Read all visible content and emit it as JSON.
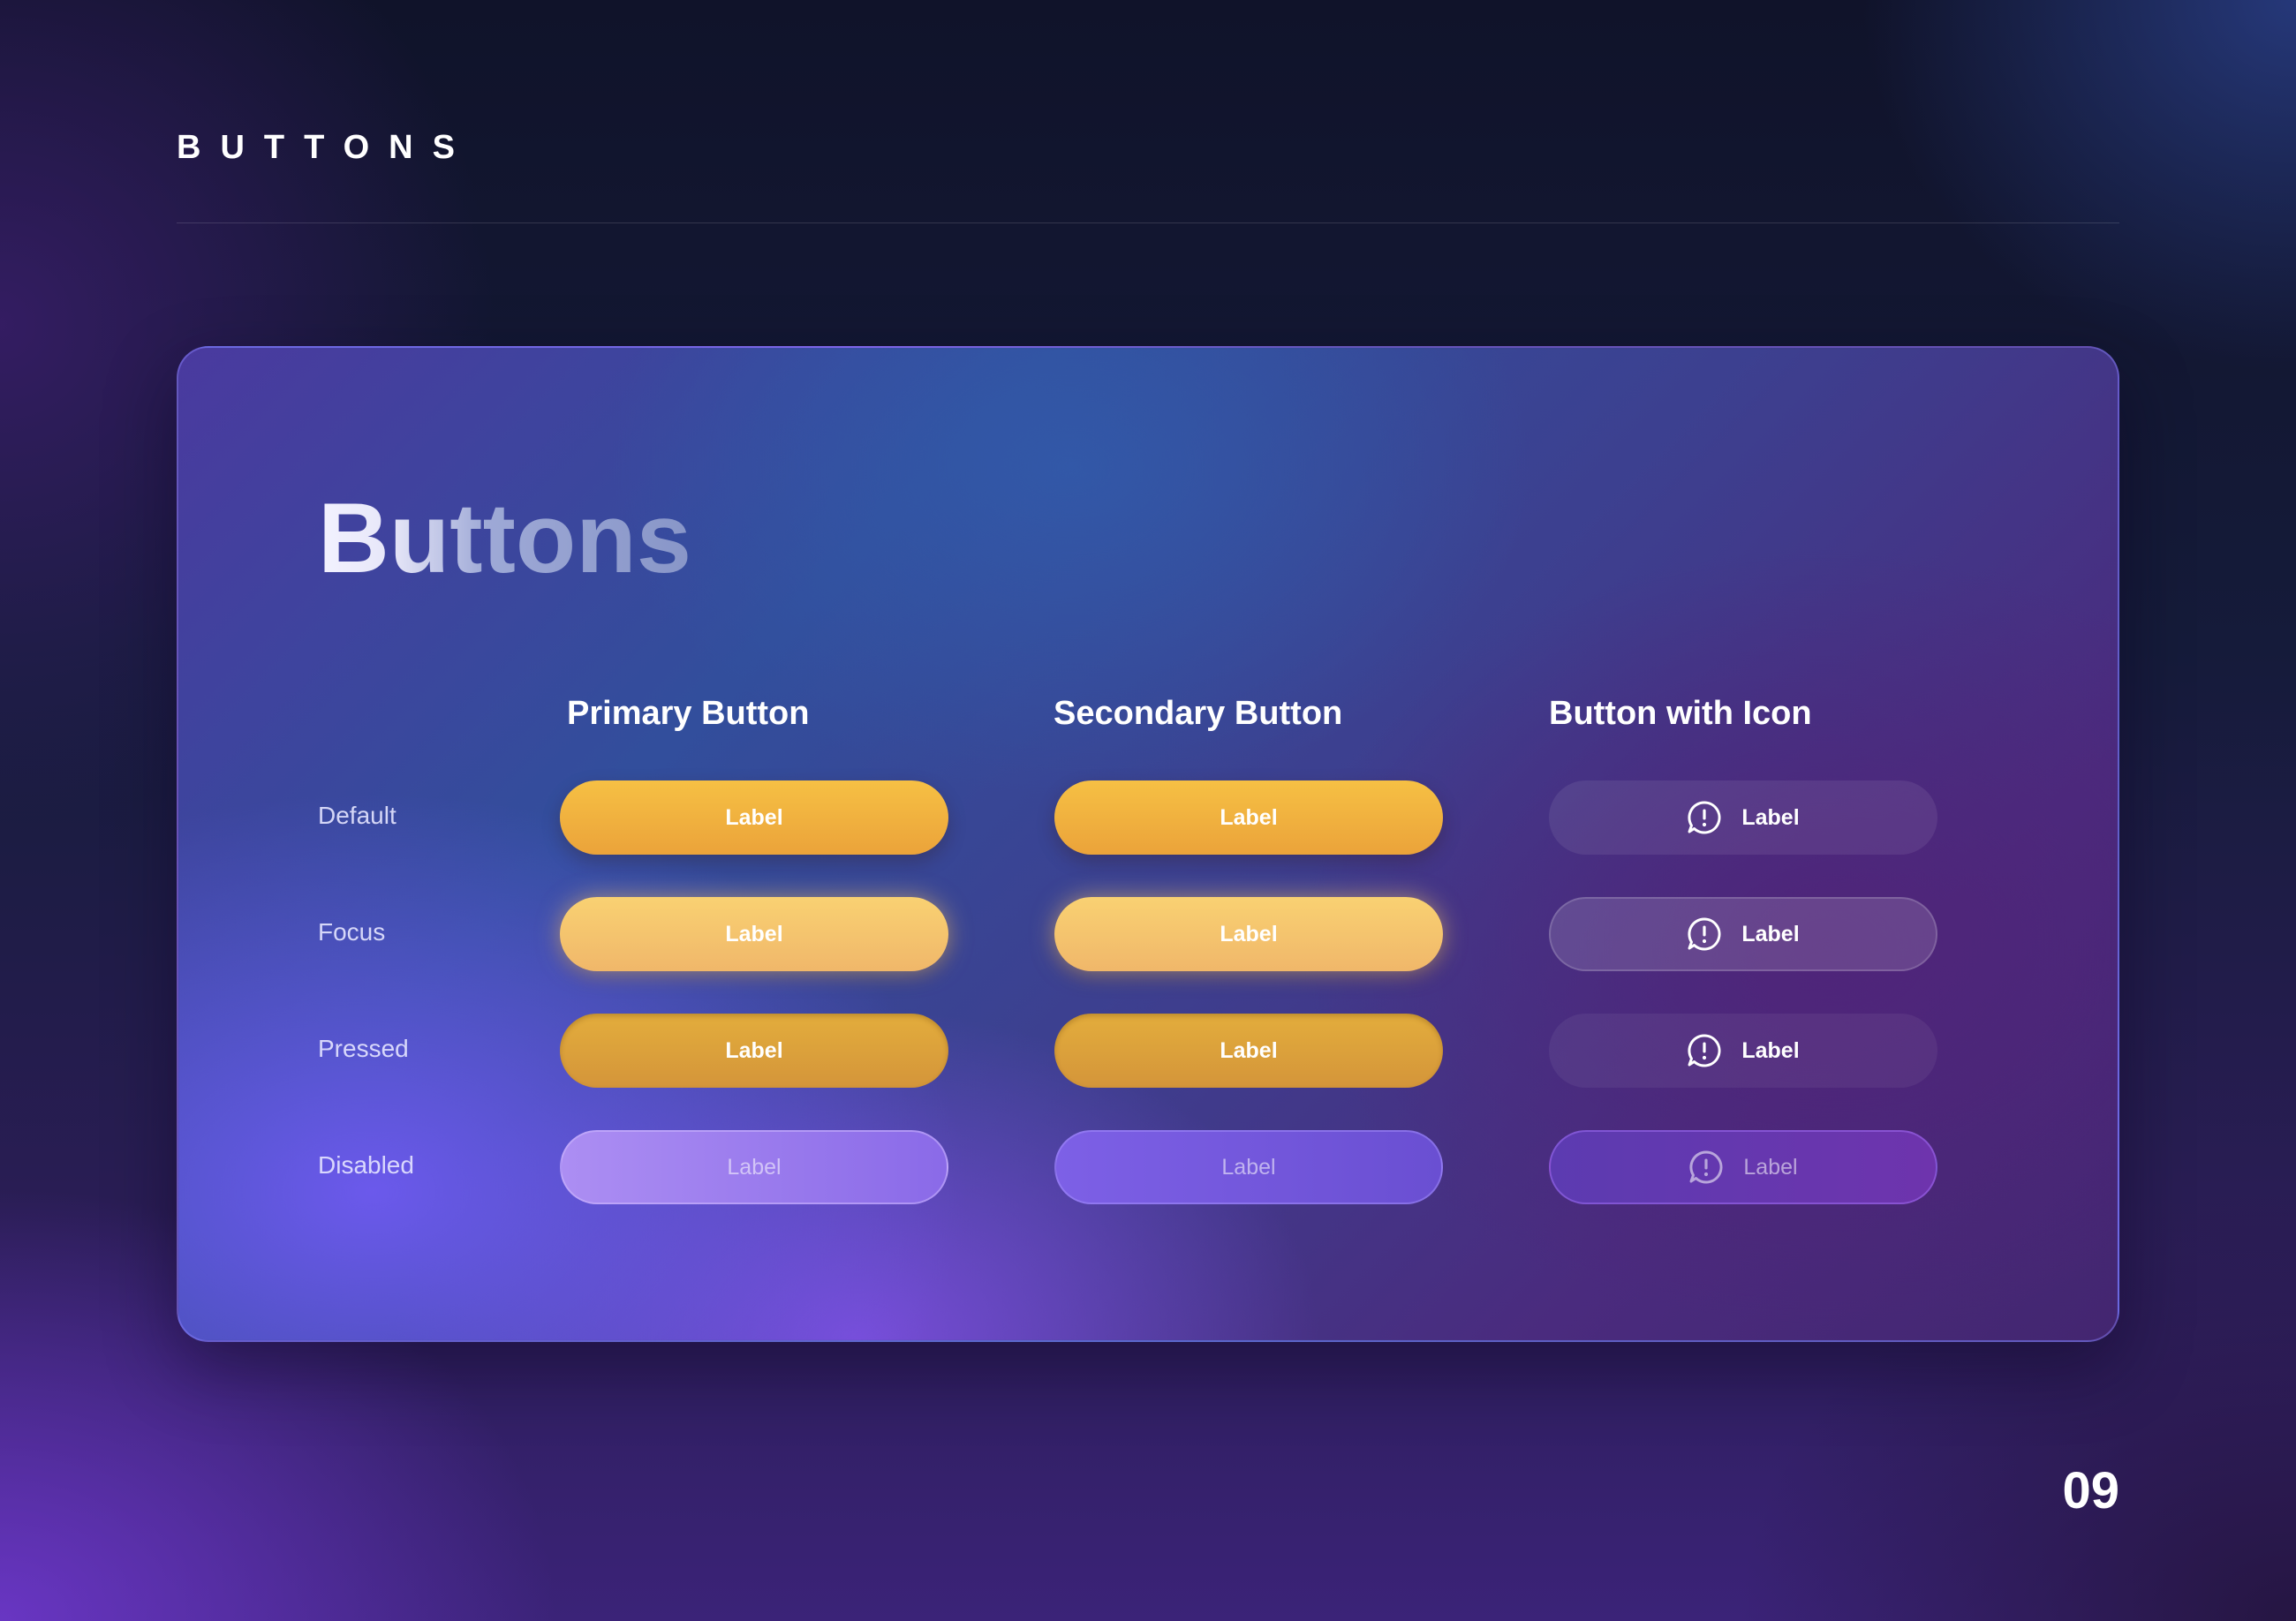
{
  "header": {
    "title": "BUTTONS"
  },
  "card": {
    "title": "Buttons",
    "columns": [
      "Primary Button",
      "Secondary Button",
      "Button with Icon"
    ],
    "rows": [
      "Default",
      "Focus",
      "Pressed",
      "Disabled"
    ],
    "button_label": "Label",
    "icon": "alert-message-icon"
  },
  "page_number": "09",
  "colors": {
    "primary_default": "#F2B13F",
    "primary_focus": "#F5C46F",
    "primary_pressed": "#DBA13B",
    "disabled_primary": "#9B7CEE",
    "disabled_secondary": "#7358DC",
    "disabled_icon": "#6538AF"
  }
}
